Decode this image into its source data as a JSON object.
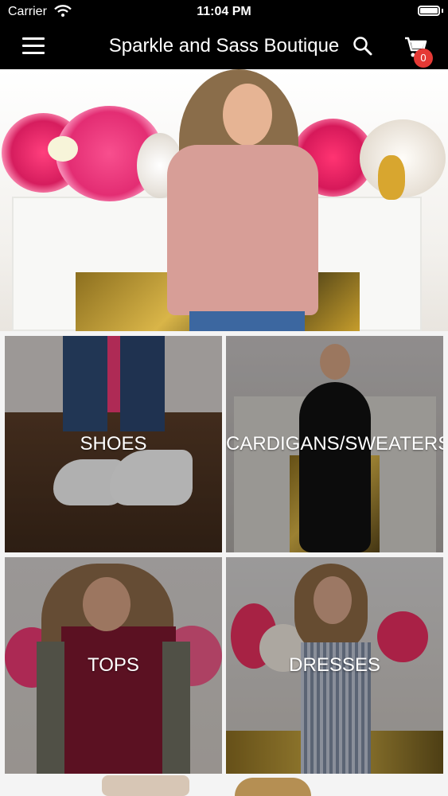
{
  "status_bar": {
    "carrier": "Carrier",
    "time": "11:04 PM"
  },
  "header": {
    "title": "Sparkle and Sass Boutique",
    "cart_count": "0",
    "menu_icon": "hamburger-menu-icon",
    "search_icon": "search-icon",
    "cart_icon": "shopping-cart-icon"
  },
  "hero": {
    "slide_count": 4,
    "active_slide_index": 1
  },
  "categories": [
    {
      "label": "SHOES"
    },
    {
      "label": "CARDIGANS/SWEATERS"
    },
    {
      "label": "TOPS"
    },
    {
      "label": "DRESSES"
    }
  ],
  "colors": {
    "header_bg": "#000000",
    "badge_bg": "#e53935",
    "hero_pink": "#d79e97"
  }
}
